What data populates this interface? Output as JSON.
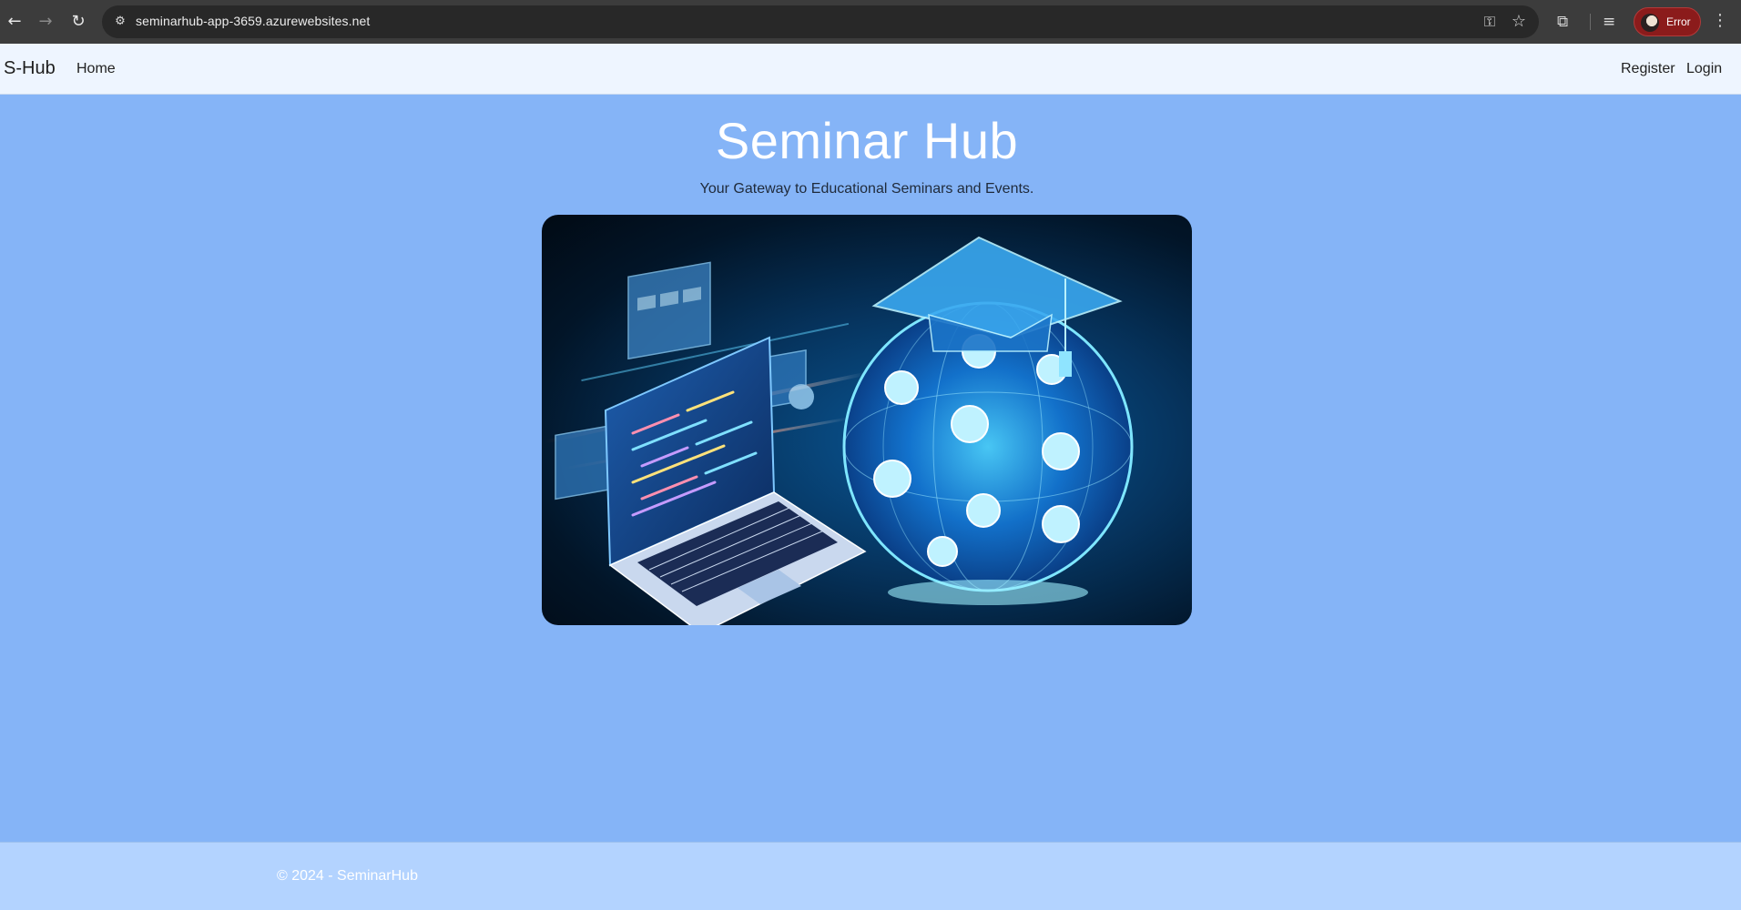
{
  "browser": {
    "url": "seminarhub-app-3659.azurewebsites.net",
    "profile_label": "Error",
    "icons": {
      "back": "back-arrow-icon",
      "forward": "forward-arrow-icon",
      "reload": "reload-icon",
      "site_info": "site-info-icon",
      "password": "key-icon",
      "bookmark": "star-icon",
      "extensions": "puzzle-icon",
      "media": "media-queue-icon",
      "menu": "kebab-menu-icon"
    }
  },
  "navbar": {
    "brand": "S-Hub",
    "home": "Home",
    "register": "Register",
    "login": "Login"
  },
  "hero": {
    "title": "Seminar Hub",
    "subtitle": "Your Gateway to Educational Seminars and Events."
  },
  "footer": {
    "copyright": "© 2024 - SeminarHub"
  },
  "colors": {
    "page_background": "#85b4f7",
    "navbar_background": "#eef5ff",
    "footer_background": "#b3d3ff",
    "chrome_background": "#3c3c3c",
    "profile_error": "#8b1b1b"
  }
}
